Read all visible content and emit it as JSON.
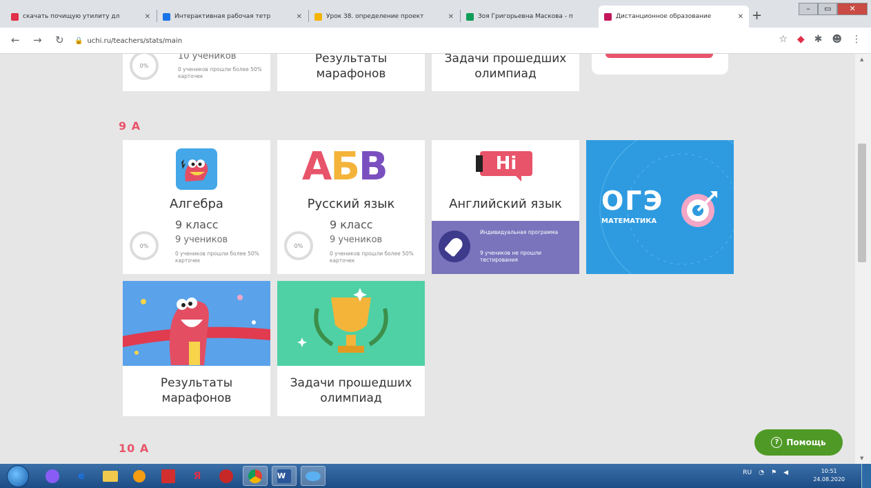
{
  "browser": {
    "tabs": [
      {
        "title": "скачать почищую утилиту дл",
        "fav": "#e0304a",
        "fav_icon": "yandex-icon"
      },
      {
        "title": "Интерактивная рабочая тетр",
        "fav": "#1a73e8",
        "fav_icon": "doc-icon"
      },
      {
        "title": "Урок 38. определение проект",
        "fav": "#f4b400",
        "fav_icon": "lesson-icon"
      },
      {
        "title": "Зоя Григорьевна Маскова - п",
        "fav": "#0f9d58",
        "fav_icon": "sheets-icon"
      },
      {
        "title": "Дистанционное образование",
        "fav": "#c2185b",
        "fav_icon": "uchi-icon"
      }
    ],
    "tab_close": "✕",
    "new_tab": "+",
    "url": "uchi.ru/teachers/stats/main"
  },
  "top_row": {
    "count": "10 учеников",
    "note": "0 учеников прошли более 50% карточек",
    "percent": "0%",
    "marathons_label": "Результаты марафонов",
    "olympiad_label": "Задачи прошедших олимпиад"
  },
  "section_9a": {
    "title": "9 А",
    "algebra": {
      "subject": "Алгебра",
      "class": "9 класс",
      "count": "9 учеников",
      "note": "0 учеников прошли более 50% карточек",
      "percent": "0%"
    },
    "russian": {
      "subject": "Русский язык",
      "logo": "АБВ",
      "class": "9 класс",
      "count": "9 учеников",
      "note": "0 учеников прошли более 50% карточек",
      "percent": "0%"
    },
    "english": {
      "subject": "Английский язык",
      "logo": "Hi",
      "program_title": "Индивидуальная программа",
      "program_note": "9 учеников не прошли тестирования"
    },
    "oge": {
      "title": "ОГЭ",
      "subtitle": "МАТЕМАТИКА"
    },
    "marathons_label": "Результаты марафонов",
    "olympiad_label": "Задачи прошедших олимпиад"
  },
  "section_10a": {
    "title": "10 А"
  },
  "help": {
    "label": "Помощь"
  },
  "taskbar": {
    "lang": "RU",
    "time": "10:51",
    "date": "24.08.2020",
    "apps": [
      "browser",
      "ie",
      "explorer",
      "media",
      "acrobat",
      "yandex",
      "opera",
      "chrome",
      "word",
      "app"
    ]
  },
  "colors": {
    "accent": "#e8546a",
    "help_green": "#4f9a26",
    "oge_blue": "#2e9be0",
    "english_purple": "#7a74bd",
    "olympiad_green": "#4fd1a5"
  }
}
